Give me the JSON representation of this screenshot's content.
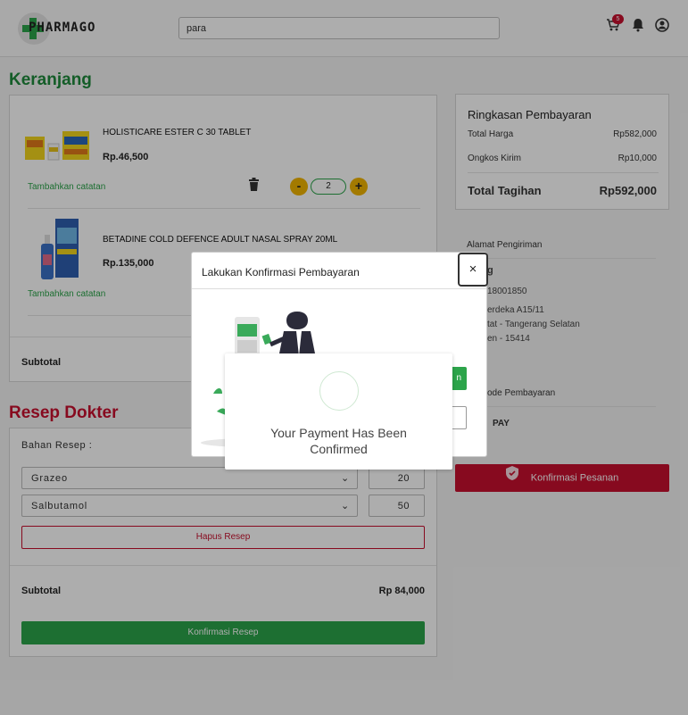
{
  "header": {
    "logo_text": "PHARMAGO",
    "search_value": "para",
    "cart_badge": "5"
  },
  "cart": {
    "title": "Keranjang",
    "items": [
      {
        "name": "HOLISTICARE ESTER C 30 TABLET",
        "price": "Rp.46,500",
        "note_link": "Tambahkan catatan",
        "qty": "2"
      },
      {
        "name": "BETADINE COLD DEFENCE ADULT NASAL SPRAY 20ML",
        "price": "Rp.135,000",
        "note_link": "Tambahkan catatan"
      }
    ],
    "subtotal_label": "Subtotal"
  },
  "summary": {
    "title": "Ringkasan Pembayaran",
    "total_harga_label": "Total Harga",
    "total_harga_value": "Rp582,000",
    "ongkos_label": "Ongkos Kirim",
    "ongkos_value": "Rp10,000",
    "tagihan_label": "Total Tagihan",
    "tagihan_value": "Rp592,000"
  },
  "shipping": {
    "label": "Alamat Pengiriman",
    "name_partial": "g",
    "phone_partial": "18001850",
    "line1_partial": "erdeka A15/11",
    "line2_partial": "tat - Tangerang Selatan",
    "line3_partial": "en - 15414"
  },
  "payment": {
    "label_partial": "ode Pembayaran",
    "method_partial": "PAY"
  },
  "confirm_order_button": "Konfirmasi Pesanan",
  "resep": {
    "title": "Resep Dokter",
    "bahan_label": "Bahan Resep :",
    "rows": [
      {
        "item": "Grazeo",
        "qty": "20"
      },
      {
        "item": "Salbutamol",
        "qty": "50"
      }
    ],
    "hapus_button": "Hapus Resep",
    "subtotal_label": "Subtotal",
    "subtotal_value": "Rp 84,000",
    "confirm_button": "Konfirmasi Resep"
  },
  "modal": {
    "title": "Lakukan Konfirmasi Pembayaran",
    "close_label": "×",
    "green_button_partial": "n"
  },
  "confirm_popup": {
    "message": "Your Payment Has Been Confirmed"
  },
  "colors": {
    "brand_green": "#2ca44a",
    "brand_red": "#c8102e",
    "accent_yellow": "#f0b400"
  }
}
